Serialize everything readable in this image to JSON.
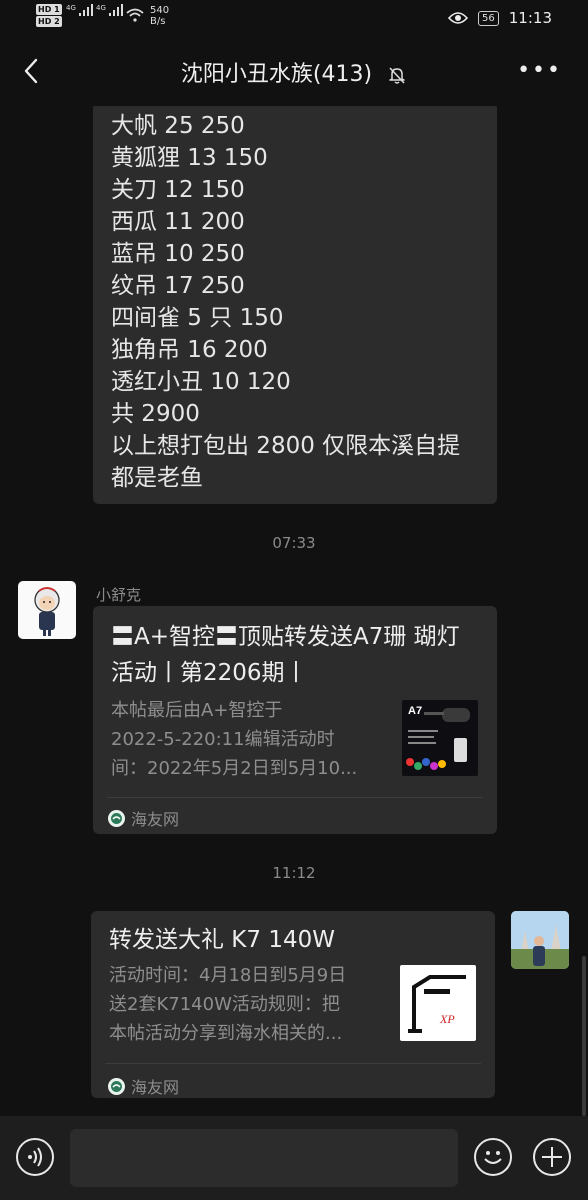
{
  "status_bar": {
    "hd1": "HD 1",
    "hd2": "HD 2",
    "net1": "4G",
    "net2": "4G",
    "speed_value": "540",
    "speed_unit": "B/s",
    "battery": "56",
    "time": "11:13"
  },
  "header": {
    "title": "沈阳小丑水族(413)",
    "back_icon": "back-arrow-icon",
    "mute_icon": "bell-muted-icon",
    "more_label": "•••"
  },
  "messages": {
    "text_lines": [
      "大帆 25 250",
      "黄狐狸 13 150",
      "关刀 12 150",
      "西瓜 11 200",
      "蓝吊 10 250",
      "纹吊 17 250",
      "四间雀 5 只 150",
      "独角吊 16 200",
      "透红小丑 10 120",
      "共 2900",
      "以上想打包出 2800 仅限本溪自提",
      "都是老鱼"
    ],
    "time1": "07:33",
    "sender1": "小舒克",
    "card1": {
      "title_line1": "〓A+智控〓顶贴转发送A7珊 瑚灯",
      "title_line2": "活动丨第2206期丨",
      "desc_line1": "本帖最后由A+智控于",
      "desc_line2": "2022-5-220:11编辑活动时",
      "desc_line3": "间：2022年5月2日到5月10...",
      "thumb_text": "A7",
      "source": "海友网"
    },
    "time2": "11:12",
    "card2": {
      "title": "转发送大礼 K7 140W",
      "desc_line1": "活动时间：4月18日到5月9日",
      "desc_line2": "送2套K7140W活动规则：把",
      "desc_line3": "本帖活动分享到海水相关的...",
      "source": "海友网"
    }
  },
  "input_bar": {
    "voice_icon": "voice-icon",
    "emoji_icon": "emoji-icon",
    "plus_icon": "plus-icon",
    "text_value": ""
  }
}
